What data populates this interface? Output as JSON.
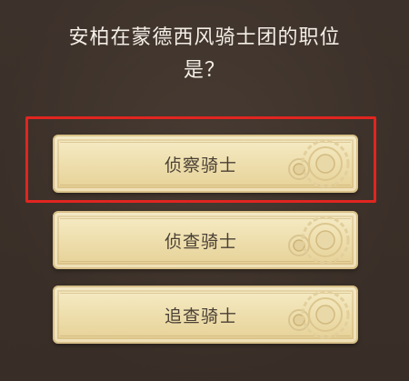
{
  "question": {
    "line1": "安柏在蒙德西风骑士团的职位",
    "line2": "是？"
  },
  "options": [
    {
      "label": "侦察骑士",
      "highlighted": true
    },
    {
      "label": "侦查骑士",
      "highlighted": false
    },
    {
      "label": "追查骑士",
      "highlighted": false
    }
  ],
  "colors": {
    "background": "#3b3029",
    "question_text": "#f3eee6",
    "option_fill": "#efe0b0",
    "option_text": "#4a4035",
    "highlight_border": "#e12520"
  },
  "icons": [
    "gear-emblem-icon",
    "small-gear-emblem-icon"
  ]
}
